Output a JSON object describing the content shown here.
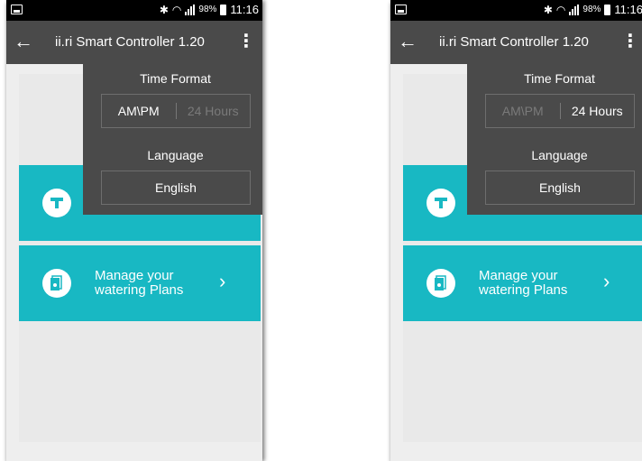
{
  "screens": [
    {
      "status": {
        "battery_pct": "98%",
        "time": "11:16"
      },
      "app_bar": {
        "back_icon": "arrow-left-icon",
        "title": "ii.ri Smart Controller 1.20",
        "menu_icon": "more-vert-icon"
      },
      "rows": [
        {
          "icon": "funnel-icon",
          "label_line1": "",
          "label_line2": ""
        },
        {
          "icon": "watering-plan-icon",
          "label_line1": "Manage your",
          "label_line2": "watering Plans"
        }
      ],
      "dropdown": {
        "time_format_label": "Time Format",
        "time_options": [
          {
            "label": "AM\\PM",
            "active": true
          },
          {
            "label": "24 Hours",
            "active": false
          }
        ],
        "language_label": "Language",
        "language_value": "English"
      }
    },
    {
      "status": {
        "battery_pct": "98%",
        "time": "11:16"
      },
      "app_bar": {
        "back_icon": "arrow-left-icon",
        "title": "ii.ri Smart Controller 1.20",
        "menu_icon": "more-vert-icon"
      },
      "rows": [
        {
          "icon": "funnel-icon",
          "label_line1": "",
          "label_line2": ""
        },
        {
          "icon": "watering-plan-icon",
          "label_line1": "Manage your",
          "label_line2": "watering Plans"
        }
      ],
      "dropdown": {
        "time_format_label": "Time Format",
        "time_options": [
          {
            "label": "AM\\PM",
            "active": false
          },
          {
            "label": "24 Hours",
            "active": true
          }
        ],
        "language_label": "Language",
        "language_value": "English"
      }
    }
  ],
  "colors": {
    "accent": "#18b8c3",
    "app_bar": "#4a4a4a",
    "status_bar": "#000000"
  }
}
